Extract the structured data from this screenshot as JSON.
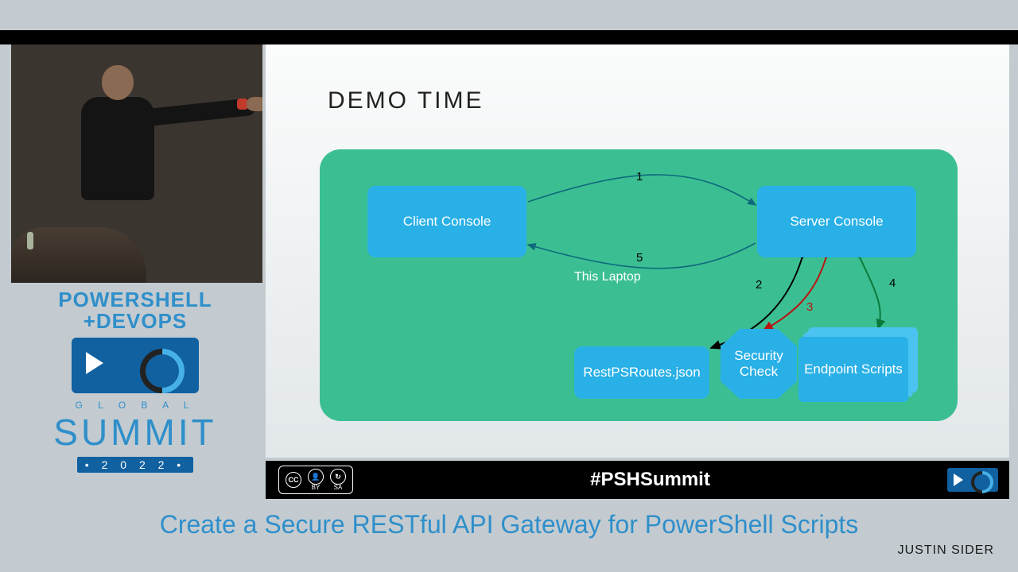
{
  "logo": {
    "line1": "POWERSHELL",
    "line2": "+DEVOPS",
    "global": "G L O B A L",
    "summit": "SUMMIT",
    "year": "• 2 0 2 2 •"
  },
  "slide": {
    "title": "DEMO TIME",
    "nodes": {
      "client": "Client Console",
      "server": "Server Console",
      "routes": "RestPSRoutes.json",
      "security": "Security Check",
      "endpoint": "Endpoint Scripts"
    },
    "labels": {
      "laptop": "This Laptop",
      "n1": "1",
      "n2": "2",
      "n3": "3",
      "n4": "4",
      "n5": "5"
    }
  },
  "footer": {
    "cc": "CC",
    "by": "BY",
    "sa": "SA",
    "hash": "#PSHSummit"
  },
  "talk": {
    "title": "Create a Secure RESTful API Gateway for PowerShell Scripts",
    "author": "JUSTIN SIDER"
  }
}
